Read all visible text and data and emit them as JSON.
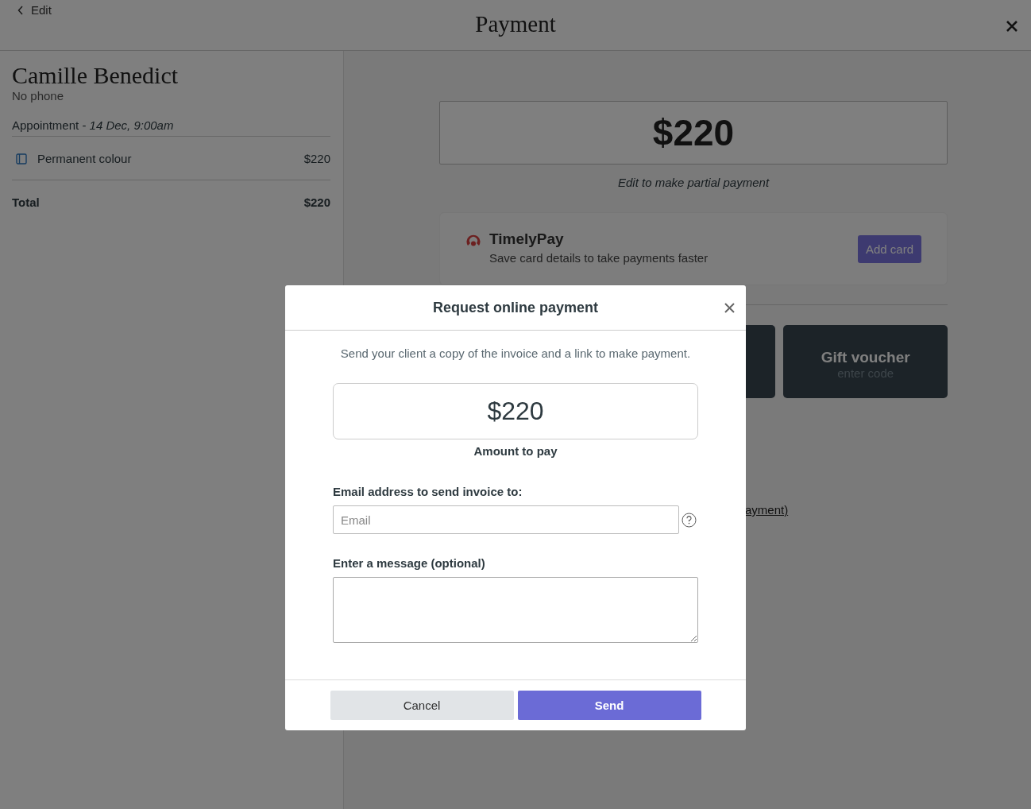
{
  "header": {
    "back_label": "Edit",
    "title": "Payment"
  },
  "client": {
    "name": "Camille Benedict",
    "phone": "No phone"
  },
  "appointment": {
    "label": "Appointment - ",
    "when": "14 Dec, 9:00am"
  },
  "items": [
    {
      "name": "Permanent colour",
      "price": "$220"
    }
  ],
  "total": {
    "label": "Total",
    "amount": "$220"
  },
  "amount": {
    "value": "$220",
    "hint": "Edit to make partial payment"
  },
  "timelypay": {
    "name": "TimelyPay",
    "description": "Save card details to take payments faster",
    "button": "Add card"
  },
  "payment_tiles": [
    {
      "kind": "covered"
    },
    {
      "kind": "labelled",
      "label": "Gift voucher",
      "sub": "enter code"
    }
  ],
  "partial_link": "ayment)",
  "dialog": {
    "title": "Request online payment",
    "intro": "Send your client a copy of the invoice and a link to make payment.",
    "amount": "$220",
    "amount_label": "Amount to pay",
    "email_label": "Email address to send invoice to:",
    "email_placeholder": "Email",
    "message_label": "Enter a message (optional)",
    "cancel": "Cancel",
    "send": "Send"
  }
}
